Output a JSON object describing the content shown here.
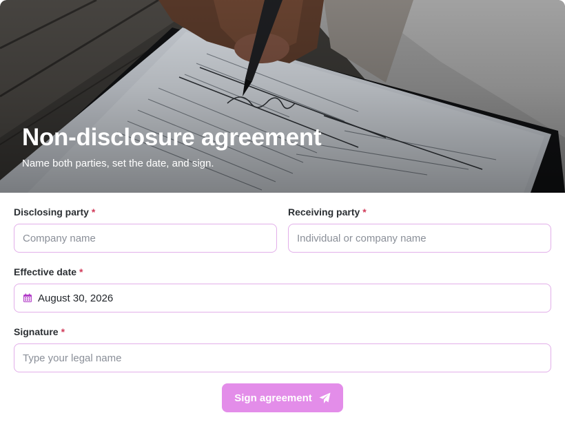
{
  "hero": {
    "title": "Non-disclosure agreement",
    "subtitle": "Name both parties, set the date, and sign.",
    "photo_icon": "document-signing-photo"
  },
  "form": {
    "disclosing_party": {
      "label": "Disclosing party",
      "required_mark": "*",
      "placeholder": "Company name",
      "value": ""
    },
    "receiving_party": {
      "label": "Receiving party",
      "required_mark": "*",
      "placeholder": "Individual or company name",
      "value": ""
    },
    "effective_date": {
      "label": "Effective date",
      "required_mark": "*",
      "value": "August 30, 2026",
      "icon": "calendar-icon"
    },
    "signature": {
      "label": "Signature",
      "required_mark": "*",
      "placeholder": "Type your legal name",
      "value": ""
    },
    "submit": {
      "label": "Sign agreement",
      "icon": "paper-plane-icon"
    }
  },
  "colors": {
    "accent": "#e38de9",
    "input_border": "#e2aee9",
    "required": "#d13b5a",
    "calendar": "#b23ec8"
  }
}
